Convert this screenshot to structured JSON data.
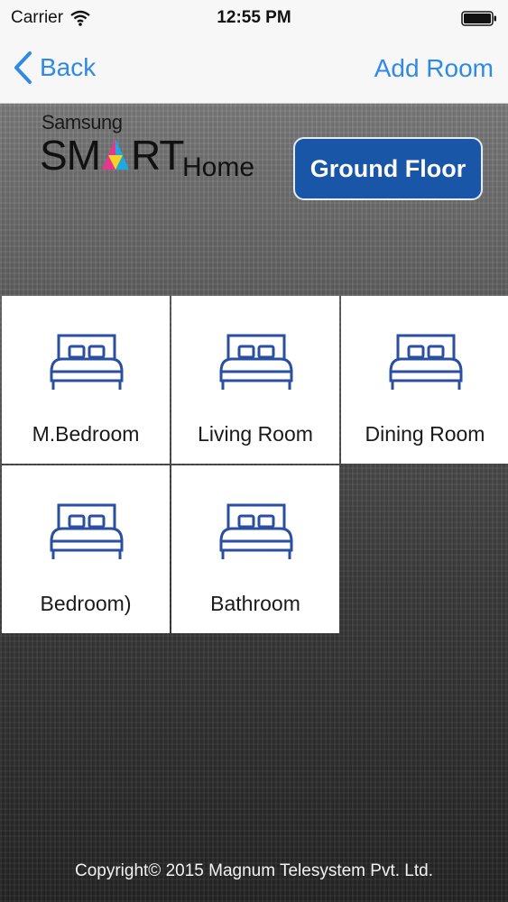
{
  "status_bar": {
    "carrier": "Carrier",
    "time": "12:55 PM"
  },
  "nav": {
    "back_label": "Back",
    "add_room_label": "Add Room"
  },
  "logo": {
    "samsung": "Samsung",
    "smart_left": "SM",
    "smart_right": "RT",
    "home": "Home"
  },
  "floor_button": {
    "label": "Ground Floor"
  },
  "rooms": [
    {
      "label": "M.Bedroom",
      "icon": "bed-icon"
    },
    {
      "label": "Living Room",
      "icon": "bed-icon"
    },
    {
      "label": "Dining Room",
      "icon": "bed-icon"
    },
    {
      "label": "Bedroom)",
      "icon": "bed-icon"
    },
    {
      "label": "Bathroom",
      "icon": "bed-icon"
    }
  ],
  "footer": {
    "copyright": "Copyright© 2015 Magnum Telesystem Pvt. Ltd."
  },
  "colors": {
    "accent": "#2f8ae5",
    "floor_button_bg": "#1a56a8",
    "icon_stroke": "#2b4fa0",
    "tile_bg": "#ffffff"
  }
}
